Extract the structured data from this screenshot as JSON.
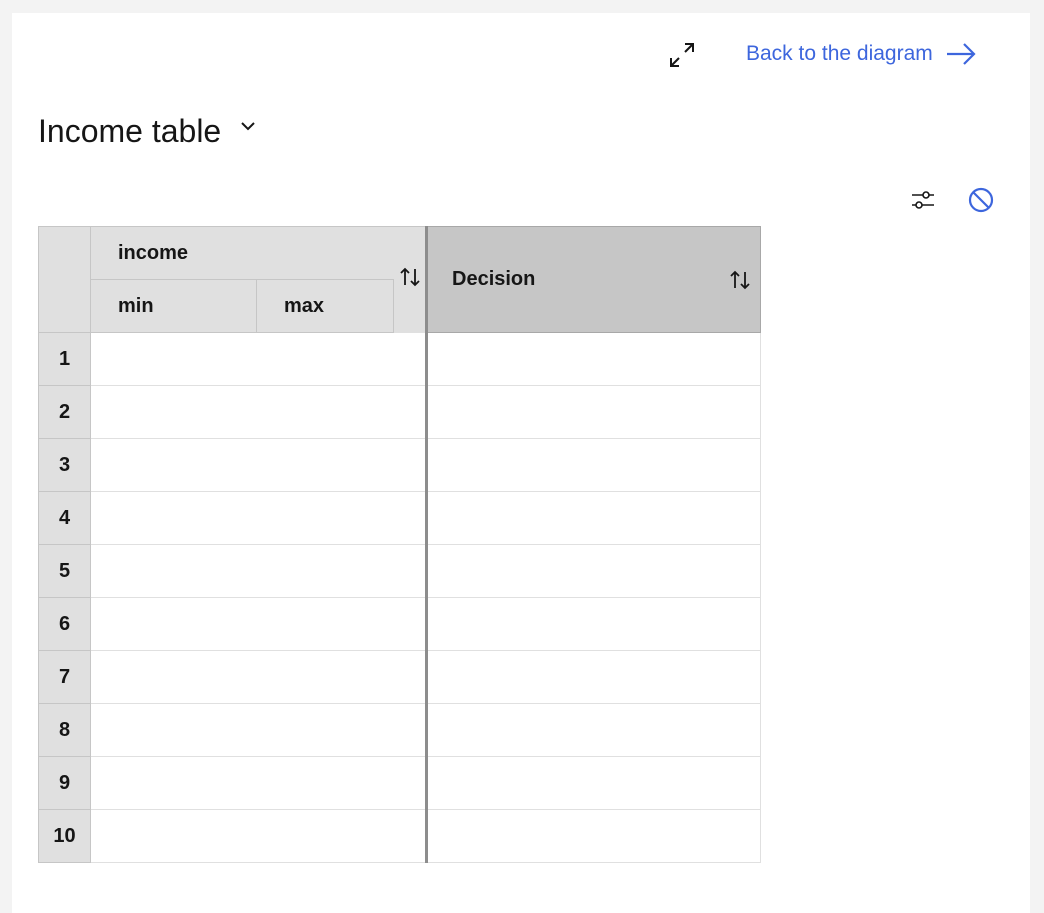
{
  "toolbar": {
    "expand_icon": "maximize-icon",
    "back_link_label": "Back to the diagram",
    "back_link_icon": "arrow-right-icon"
  },
  "table": {
    "title": "Income table",
    "title_dropdown_icon": "chevron-down-icon",
    "tools": [
      "settings-adjust-icon",
      "disable-icon"
    ],
    "input_column": {
      "label": "income",
      "subcolumns": [
        "min",
        "max"
      ]
    },
    "output_column": {
      "label": "Decision"
    },
    "rows": [
      "1",
      "2",
      "3",
      "4",
      "5",
      "6",
      "7",
      "8",
      "9",
      "10"
    ]
  },
  "colors": {
    "accent": "#3d66dd",
    "header_bg": "#e0e0e0",
    "output_header_bg": "#c6c6c6"
  }
}
